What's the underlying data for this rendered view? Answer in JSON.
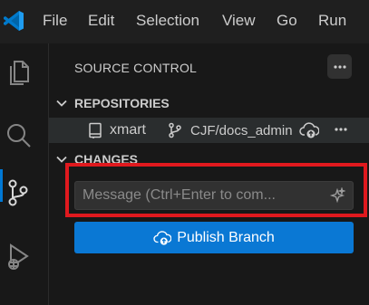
{
  "menubar": {
    "logo_icon": "vscode-logo",
    "items": [
      "File",
      "Edit",
      "Selection",
      "View",
      "Go",
      "Run"
    ]
  },
  "activitybar": {
    "icons": [
      "explorer-icon",
      "search-icon",
      "source-control-icon",
      "run-debug-icon"
    ],
    "active": "source-control-icon"
  },
  "sidebar": {
    "title": "SOURCE CONTROL",
    "more_icon": "ellipsis-icon",
    "repositories_header": "REPOSITORIES",
    "repo": {
      "name": "xmart",
      "branch": "CJF/docs_admin",
      "actions": [
        "publish-cloud-icon",
        "ellipsis-icon"
      ]
    },
    "changes_header": "CHANGES",
    "commit_message": {
      "value": "",
      "placeholder": "Message (Ctrl+Enter to com..."
    },
    "publish_button": "Publish Branch"
  },
  "colors": {
    "accent": "#0a78d4",
    "highlight": "#e0191e",
    "background": "#181818"
  }
}
